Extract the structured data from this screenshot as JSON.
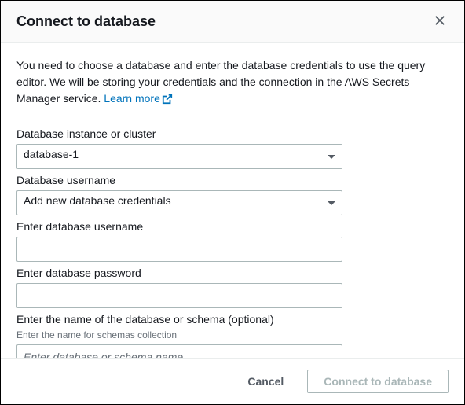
{
  "header": {
    "title": "Connect to database"
  },
  "intro": {
    "text": "You need to choose a database and enter the database credentials to use the query editor. We will be storing your credentials and the connection in the AWS Secrets Manager service. ",
    "link_label": "Learn more"
  },
  "fields": {
    "instance": {
      "label": "Database instance or cluster",
      "value": "database-1"
    },
    "db_username_select": {
      "label": "Database username",
      "value": "Add new database credentials"
    },
    "enter_username": {
      "label": "Enter database username",
      "value": ""
    },
    "enter_password": {
      "label": "Enter database password",
      "value": ""
    },
    "schema": {
      "label": "Enter the name of the database or schema (optional)",
      "hint": "Enter the name for schemas collection",
      "placeholder": "Enter database or schema name",
      "value": ""
    }
  },
  "footer": {
    "cancel_label": "Cancel",
    "primary_label": "Connect to database"
  }
}
